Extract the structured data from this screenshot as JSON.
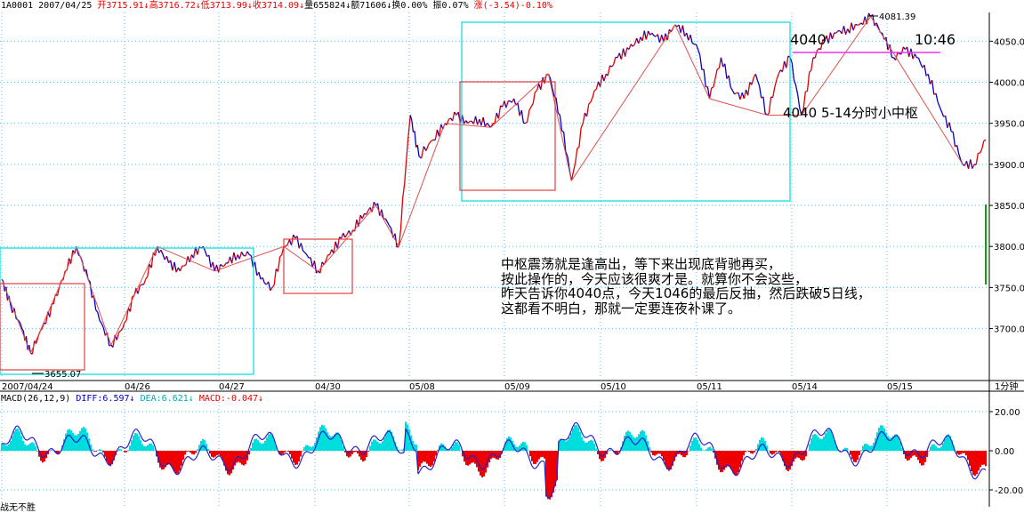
{
  "header": {
    "symbol": "1A0001",
    "date": "2007/04/25",
    "open": "开3715.91↓",
    "high": "高3716.72↓",
    "low": "低3713.99↓",
    "close": "收3714.09↓",
    "volume": "量655824↓",
    "amount": "额71606↓",
    "turnover": "换0.00%",
    "amplitude": "振0.07%",
    "change": "涨(-3.54)-0.10%"
  },
  "macd": {
    "name": "MACD(26,12,9)",
    "diff": "DIFF:6.597↓",
    "dea": "DEA:6.621↓",
    "macd": "MACD:-0.047↓"
  },
  "annotations": {
    "level": "4040",
    "time": "10:46",
    "pivot_note": "4040 5-14分时小中枢",
    "high_label": "4081.39",
    "low_label": "3655.07",
    "period": "1分钟"
  },
  "commentary": [
    "中枢震荡就是逢高出，等下来出现底背驰再买，",
    "按此操作的，今天应该很爽才是。就算你不会这些，",
    "昨天告诉你4040点，今天1046的最后反抽，然后跌破5日线，",
    "这都看不明白，那就一定要连夜补课了。"
  ],
  "footer_text": "战无不胜",
  "colors": {
    "up": "#e00000",
    "down": "#0000cc",
    "grid": "#66bbee",
    "zs_cyan": "#00dddd",
    "zs_red": "#e04040",
    "level_line": "#ee33ee",
    "macd_pos": "#00dddd",
    "macd_neg": "#ee0000"
  },
  "chart_data": {
    "type": "line",
    "x_dates": [
      "2007/04/24",
      "04/26",
      "04/27",
      "04/30",
      "05/08",
      "05/09",
      "05/10",
      "05/11",
      "05/14",
      "05/15"
    ],
    "y_ticks": [
      4050,
      4000,
      3950,
      3900,
      3850,
      3800,
      3750,
      3700
    ],
    "ylim": [
      3640,
      4085
    ],
    "price_path": [
      [
        0,
        3760
      ],
      [
        3,
        3730
      ],
      [
        7,
        3700
      ],
      [
        10,
        3670
      ],
      [
        14,
        3700
      ],
      [
        18,
        3730
      ],
      [
        22,
        3770
      ],
      [
        26,
        3800
      ],
      [
        30,
        3760
      ],
      [
        34,
        3710
      ],
      [
        38,
        3680
      ],
      [
        42,
        3700
      ],
      [
        46,
        3740
      ],
      [
        50,
        3760
      ],
      [
        54,
        3800
      ],
      [
        58,
        3780
      ],
      [
        62,
        3770
      ],
      [
        66,
        3790
      ],
      [
        70,
        3800
      ],
      [
        74,
        3770
      ],
      [
        78,
        3780
      ],
      [
        82,
        3790
      ],
      [
        86,
        3790
      ],
      [
        90,
        3760
      ],
      [
        94,
        3750
      ],
      [
        98,
        3800
      ],
      [
        102,
        3810
      ],
      [
        106,
        3790
      ],
      [
        110,
        3770
      ],
      [
        114,
        3790
      ],
      [
        118,
        3810
      ],
      [
        122,
        3820
      ],
      [
        126,
        3840
      ],
      [
        130,
        3850
      ],
      [
        134,
        3830
      ],
      [
        138,
        3800
      ],
      [
        142,
        3960
      ],
      [
        145,
        3910
      ],
      [
        150,
        3930
      ],
      [
        154,
        3950
      ],
      [
        158,
        3960
      ],
      [
        162,
        3950
      ],
      [
        166,
        3955
      ],
      [
        170,
        3945
      ],
      [
        174,
        3970
      ],
      [
        178,
        3980
      ],
      [
        182,
        3950
      ],
      [
        186,
        3990
      ],
      [
        190,
        4010
      ],
      [
        194,
        3960
      ],
      [
        198,
        3880
      ],
      [
        202,
        3950
      ],
      [
        206,
        3990
      ],
      [
        210,
        4010
      ],
      [
        214,
        4030
      ],
      [
        218,
        4040
      ],
      [
        222,
        4055
      ],
      [
        226,
        4060
      ],
      [
        230,
        4050
      ],
      [
        234,
        4070
      ],
      [
        238,
        4060
      ],
      [
        242,
        4040
      ],
      [
        246,
        3980
      ],
      [
        250,
        4030
      ],
      [
        254,
        3990
      ],
      [
        258,
        3980
      ],
      [
        262,
        4010
      ],
      [
        266,
        3960
      ],
      [
        270,
        4010
      ],
      [
        274,
        4030
      ],
      [
        278,
        3960
      ],
      [
        282,
        4030
      ],
      [
        286,
        4050
      ],
      [
        290,
        4060
      ],
      [
        294,
        4065
      ],
      [
        298,
        4070
      ],
      [
        302,
        4080
      ],
      [
        306,
        4060
      ],
      [
        310,
        4030
      ],
      [
        314,
        4040
      ],
      [
        318,
        4030
      ],
      [
        322,
        4010
      ],
      [
        326,
        3970
      ],
      [
        330,
        3940
      ],
      [
        334,
        3900
      ],
      [
        338,
        3900
      ],
      [
        342,
        3930
      ]
    ],
    "macd_series": {
      "diff_range": [
        -25,
        25
      ],
      "histogram_note": "oscillates around zero"
    }
  }
}
